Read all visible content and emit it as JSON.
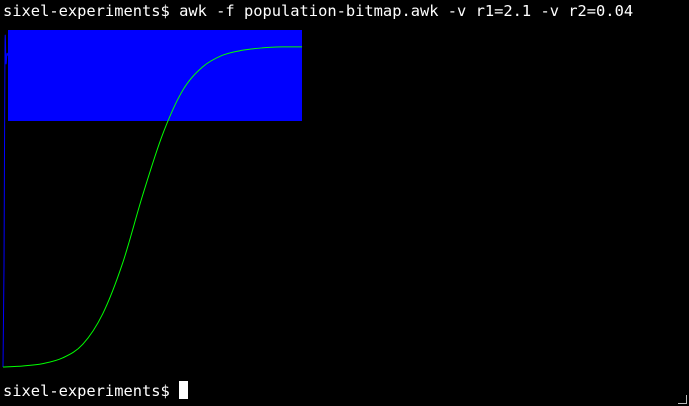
{
  "terminal": {
    "prompt": "sixel-experiments$",
    "command": "awk -f population-bitmap.awk -v r1=2.1 -v r2=0.04"
  },
  "chart_data": {
    "type": "line",
    "series": [
      {
        "color": "#0000ff",
        "x": [
          0,
          1,
          2,
          3,
          4,
          5,
          6,
          8,
          10,
          14,
          20,
          60,
          120,
          180,
          240,
          300
        ],
        "y": [
          0.003,
          0.3,
          0.95,
          0.9,
          0.93,
          0.925,
          0.928,
          0.927,
          0.927,
          0.927,
          0.927,
          0.927,
          0.927,
          0.927,
          0.927,
          0.927
        ]
      },
      {
        "color": "#00ff00",
        "x": [
          0,
          20,
          40,
          60,
          80,
          100,
          120,
          140,
          160,
          180,
          200,
          220,
          240,
          260,
          280,
          300
        ],
        "y": [
          0.003,
          0.006,
          0.013,
          0.03,
          0.07,
          0.16,
          0.31,
          0.51,
          0.69,
          0.82,
          0.89,
          0.925,
          0.94,
          0.947,
          0.95,
          0.95
        ]
      }
    ],
    "band_color": "#0000ff",
    "xlim": [
      0,
      300
    ],
    "ylim": [
      0,
      1
    ],
    "grid": false
  }
}
